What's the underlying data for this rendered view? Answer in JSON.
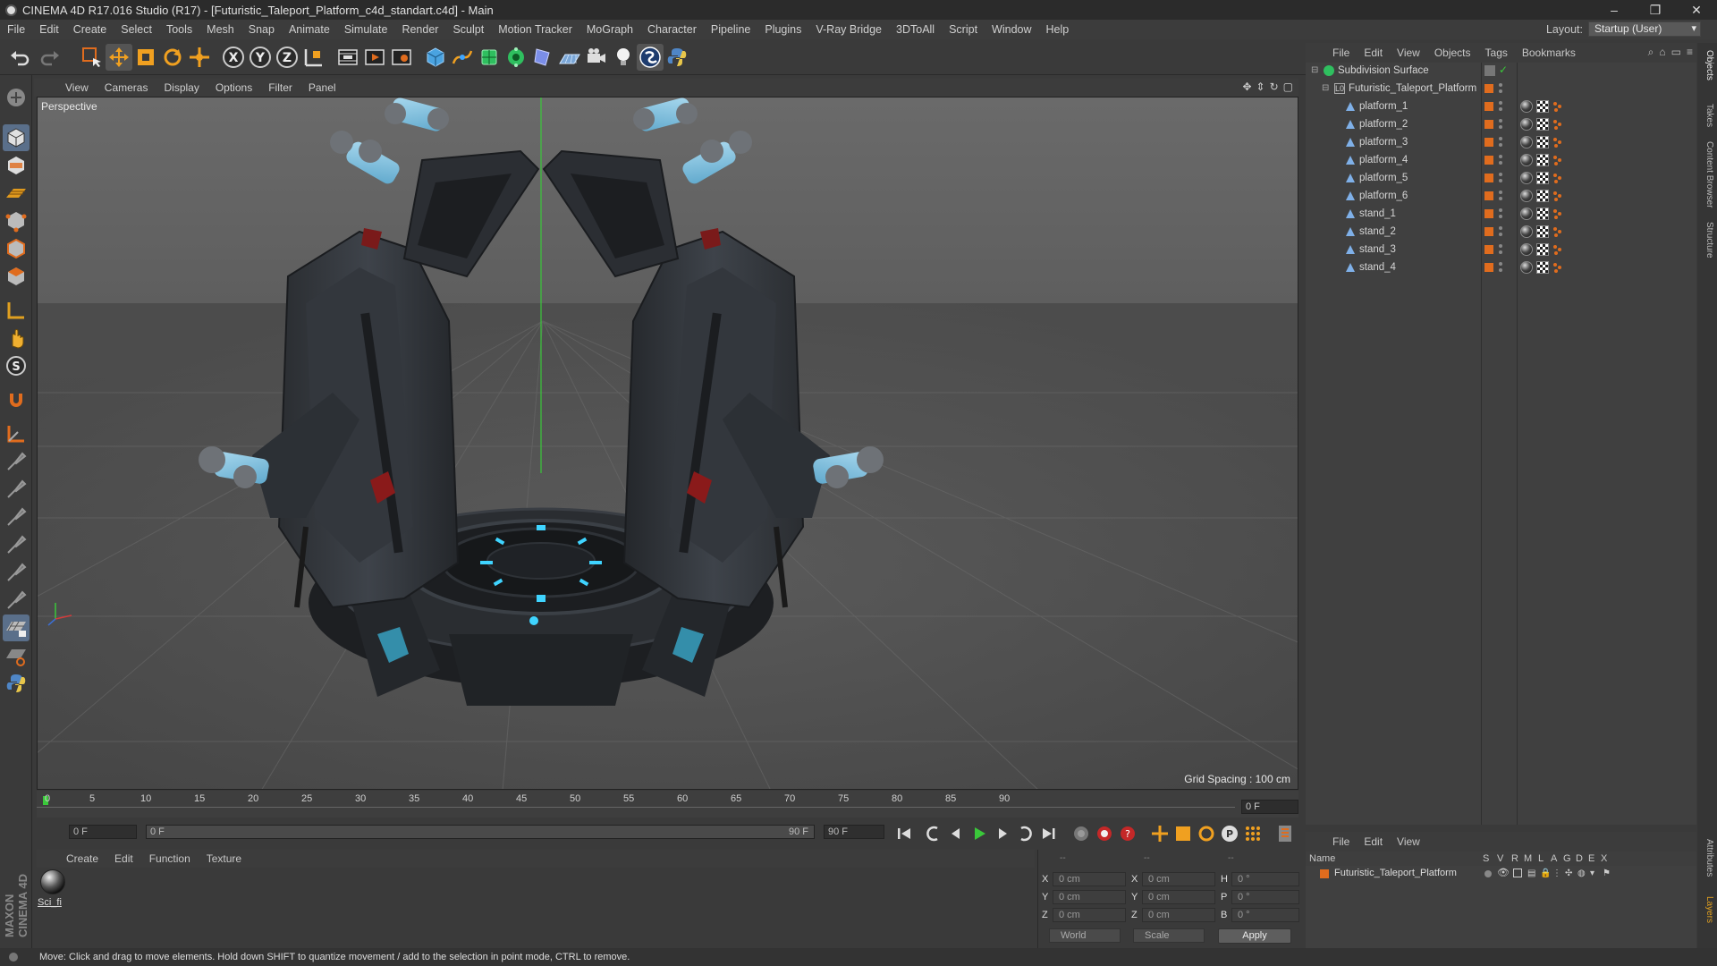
{
  "window": {
    "title": "CINEMA 4D R17.016 Studio (R17) - [Futuristic_Taleport_Platform_c4d_standart.c4d] - Main",
    "controls": [
      "–",
      "❐",
      "✕"
    ]
  },
  "menubar": {
    "items": [
      "File",
      "Edit",
      "Create",
      "Select",
      "Tools",
      "Mesh",
      "Snap",
      "Animate",
      "Simulate",
      "Render",
      "Sculpt",
      "Motion Tracker",
      "MoGraph",
      "Character",
      "Pipeline",
      "Plugins",
      "V-Ray Bridge",
      "3DToAll",
      "Script",
      "Window",
      "Help"
    ],
    "layout_label": "Layout:",
    "layout_value": "Startup (User)"
  },
  "toolbar": {
    "axis_x": "X",
    "axis_y": "Y",
    "axis_z": "Z"
  },
  "viewport": {
    "menu": [
      "View",
      "Cameras",
      "Display",
      "Options",
      "Filter",
      "Panel"
    ],
    "label": "Perspective",
    "grid_spacing": "Grid Spacing : 100 cm",
    "nav_icons": [
      "✥",
      "⇕",
      "↻",
      "▢"
    ]
  },
  "timeline": {
    "ticks": [
      "0",
      "5",
      "10",
      "15",
      "20",
      "25",
      "30",
      "35",
      "40",
      "45",
      "50",
      "55",
      "60",
      "65",
      "70",
      "75",
      "80",
      "85",
      "90"
    ],
    "frame_right": "0 F",
    "start_field": "0 F",
    "range_start": "0 F",
    "range_end": "90 F",
    "end_field": "90 F"
  },
  "material_manager": {
    "menu": [
      "Create",
      "Edit",
      "Function",
      "Texture"
    ],
    "material_name": "Sci_fi"
  },
  "coordinates": {
    "col_headers": [
      "--",
      "--",
      "--"
    ],
    "rows": [
      {
        "axis": "X",
        "pos": "0 cm",
        "axis2": "X",
        "size": "0 cm",
        "rlabel": "H",
        "rot": "0 °"
      },
      {
        "axis": "Y",
        "pos": "0 cm",
        "axis2": "Y",
        "size": "0 cm",
        "rlabel": "P",
        "rot": "0 °"
      },
      {
        "axis": "Z",
        "pos": "0 cm",
        "axis2": "Z",
        "size": "0 cm",
        "rlabel": "B",
        "rot": "0 °"
      }
    ],
    "mode_world": "World",
    "mode_scale": "Scale",
    "apply": "Apply"
  },
  "status": {
    "text": "Move: Click and drag to move elements. Hold down SHIFT to quantize movement / add to the selection in point mode, CTRL to remove."
  },
  "object_manager": {
    "menu": [
      "File",
      "Edit",
      "View",
      "Objects",
      "Tags",
      "Bookmarks"
    ],
    "objects": [
      {
        "name": "Subdivision Surface",
        "level": 0,
        "type": "subdivision"
      },
      {
        "name": "Futuristic_Taleport_Platform",
        "level": 1,
        "type": "null"
      },
      {
        "name": "platform_1",
        "level": 2,
        "type": "mesh"
      },
      {
        "name": "platform_2",
        "level": 2,
        "type": "mesh"
      },
      {
        "name": "platform_3",
        "level": 2,
        "type": "mesh"
      },
      {
        "name": "platform_4",
        "level": 2,
        "type": "mesh"
      },
      {
        "name": "platform_5",
        "level": 2,
        "type": "mesh"
      },
      {
        "name": "platform_6",
        "level": 2,
        "type": "mesh"
      },
      {
        "name": "stand_1",
        "level": 2,
        "type": "mesh"
      },
      {
        "name": "stand_2",
        "level": 2,
        "type": "mesh"
      },
      {
        "name": "stand_3",
        "level": 2,
        "type": "mesh"
      },
      {
        "name": "stand_4",
        "level": 2,
        "type": "mesh"
      }
    ]
  },
  "right_tabs": [
    "Objects",
    "Takes",
    "Content Browser",
    "Structure",
    "Attributes",
    "Layers"
  ],
  "layers_manager": {
    "menu": [
      "File",
      "Edit",
      "View"
    ],
    "headers": [
      "Name",
      "S",
      "V",
      "R",
      "M",
      "L",
      "A",
      "G",
      "D",
      "E",
      "X"
    ],
    "selected_object": "Futuristic_Taleport_Platform"
  },
  "colors": {
    "accent_orange": "#e06c1e",
    "selection_blue": "#5a6f8a",
    "glow_cyan": "#3fd4ff"
  }
}
